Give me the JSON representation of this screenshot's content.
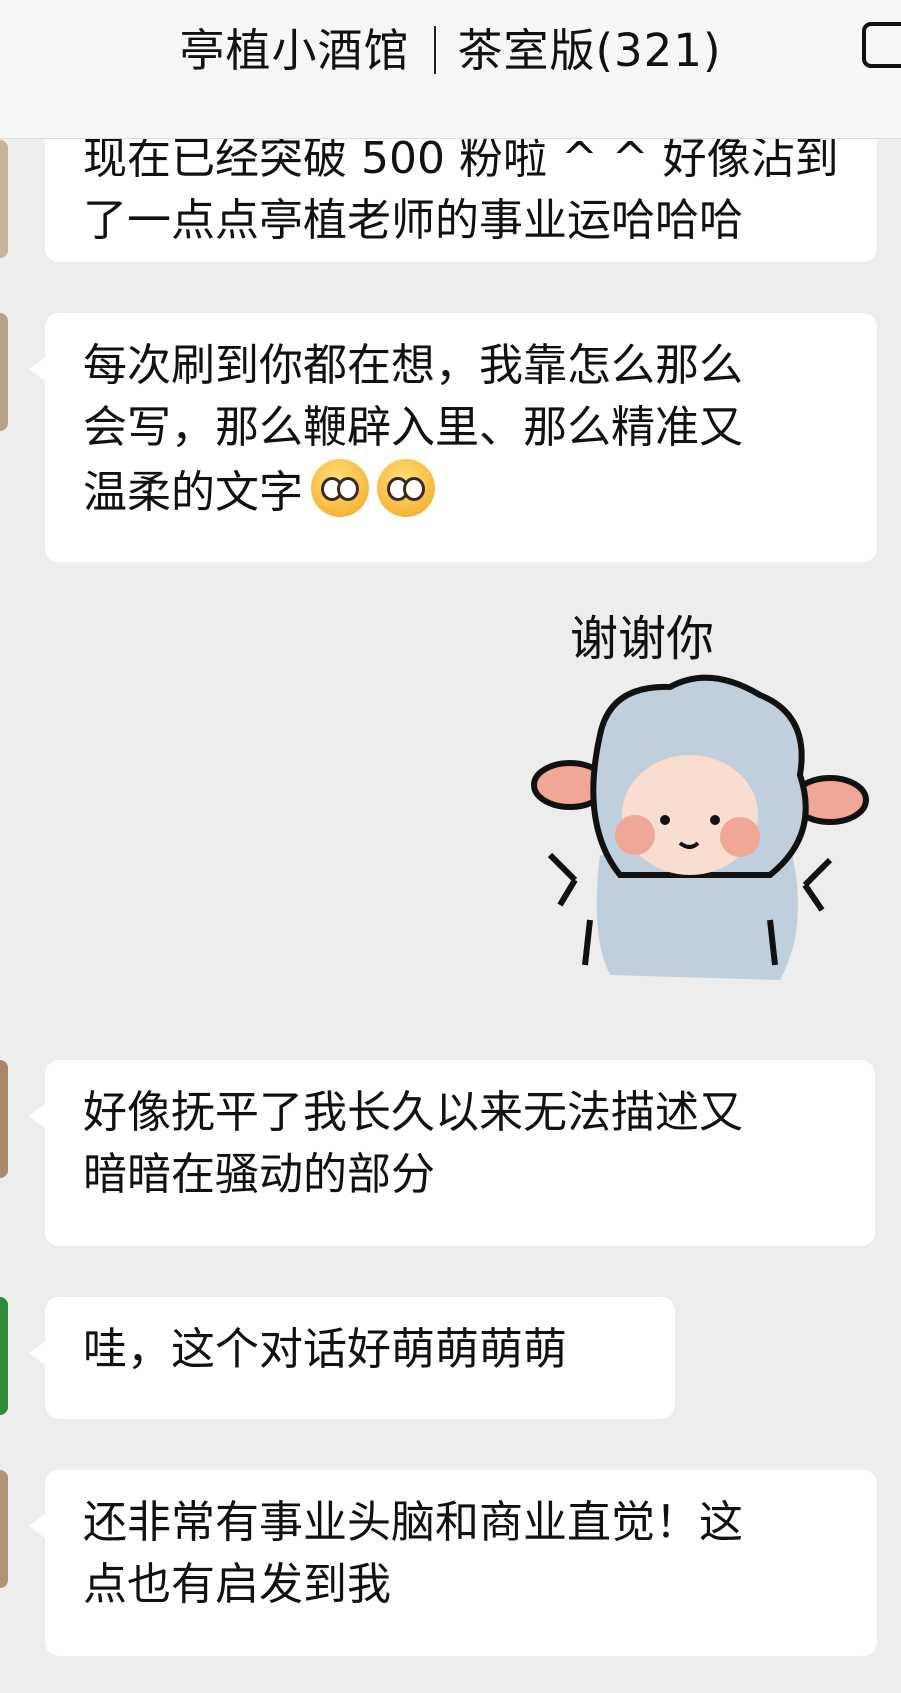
{
  "header": {
    "group_name": "亭植小酒馆",
    "group_sub": "茶室版(321)",
    "more_icon": "more-icon"
  },
  "messages": [
    {
      "lines": [
        "现在已经突破 500 粉啦 ^ ^ 好像沾到",
        "了一点点亭植老师的事业运哈哈哈"
      ],
      "avatar_color": "#c9b39a"
    },
    {
      "lines": [
        "每次刷到你都在想，我靠怎么那么",
        "会写，那么鞭辟入里、那么精准又",
        "温柔的文字"
      ],
      "emojis": [
        "pleading-face-icon",
        "pleading-face-icon"
      ],
      "avatar_color": "#b8a089"
    },
    {
      "sticker_caption": "谢谢你",
      "sticker_icon": "sheep-thank-you-sticker"
    },
    {
      "lines": [
        "好像抚平了我长久以来无法描述又",
        "暗暗在骚动的部分"
      ],
      "avatar_color": "#a9876a"
    },
    {
      "lines": [
        "哇，这个对话好萌萌萌萌"
      ],
      "avatar_color": "#2f8a3a"
    },
    {
      "lines": [
        "还非常有事业头脑和商业直觉！这",
        "点也有启发到我"
      ],
      "avatar_color": "#b09478"
    }
  ],
  "colors": {
    "background": "#ededed",
    "bubble": "#ffffff",
    "header": "#f7f7f7",
    "sheep_body": "#bfcfdb",
    "sheep_ear": "#f0a795"
  }
}
